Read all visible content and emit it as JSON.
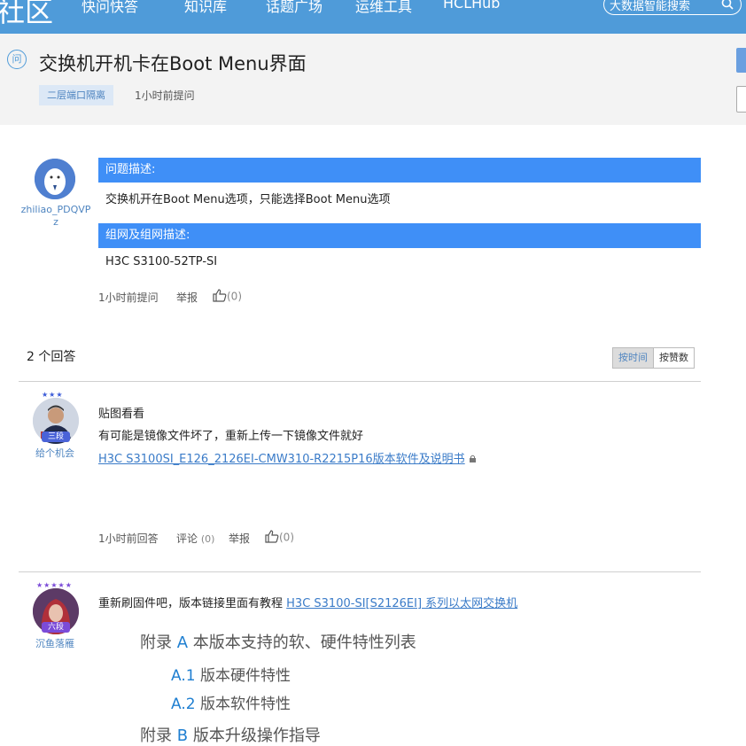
{
  "nav": {
    "logo": "社区",
    "items": [
      "快问快答",
      "知识库",
      "话题广场",
      "运维工具",
      "HCLHub"
    ],
    "search_placeholder": "大数据智能搜索"
  },
  "question": {
    "badge": "问",
    "title": "交换机开机卡在Boot Menu界面",
    "tag": "二层端口隔离",
    "time": "1小时前提问",
    "user": "zhiliao_PDQVPz",
    "desc_label": "问题描述:",
    "desc_text": "交换机开在Boot Menu选项，只能选择Boot Menu选项",
    "network_label": "组网及组网描述:",
    "network_text": "H3C S3100-52TP-SI",
    "meta_time": "1小时前提问",
    "report": "举报",
    "likes": "(0)"
  },
  "answers_header": {
    "count": "2",
    "count_label": "个回答",
    "sort_time": "按时间",
    "sort_likes": "按赞数"
  },
  "answers": [
    {
      "user": "给个机会",
      "rank": "三段",
      "lines": [
        "贴图看看",
        "有可能是镜像文件坏了，重新上传一下镜像文件就好"
      ],
      "link": "H3C S3100SI_E126_2126EI-CMW310-R2215P16版本软件及说明书",
      "time": "1小时前回答",
      "comment": "评论",
      "comment_count": "(0)",
      "report": "举报",
      "likes": "(0)"
    },
    {
      "user": "沉鱼落雁",
      "rank": "六段",
      "text": "重新刷固件吧，版本链接里面有教程",
      "link": "H3C S3100-SI[S2126EI] 系列以太网交换机",
      "doc": [
        {
          "prefix": "附录 ",
          "num": "A",
          "text": " 本版本支持的软、硬件特性列表"
        },
        {
          "prefix": "",
          "num": "A.1",
          "text": " 版本硬件特性"
        },
        {
          "prefix": "",
          "num": "A.2",
          "text": " 版本软件特性"
        },
        {
          "prefix": "附录 ",
          "num": "B",
          "text": " 版本升级操作指导"
        }
      ]
    }
  ],
  "colors": {
    "nav": "#4f9bd9",
    "bar": "#3f8ff7",
    "link": "#3a7bc8"
  }
}
